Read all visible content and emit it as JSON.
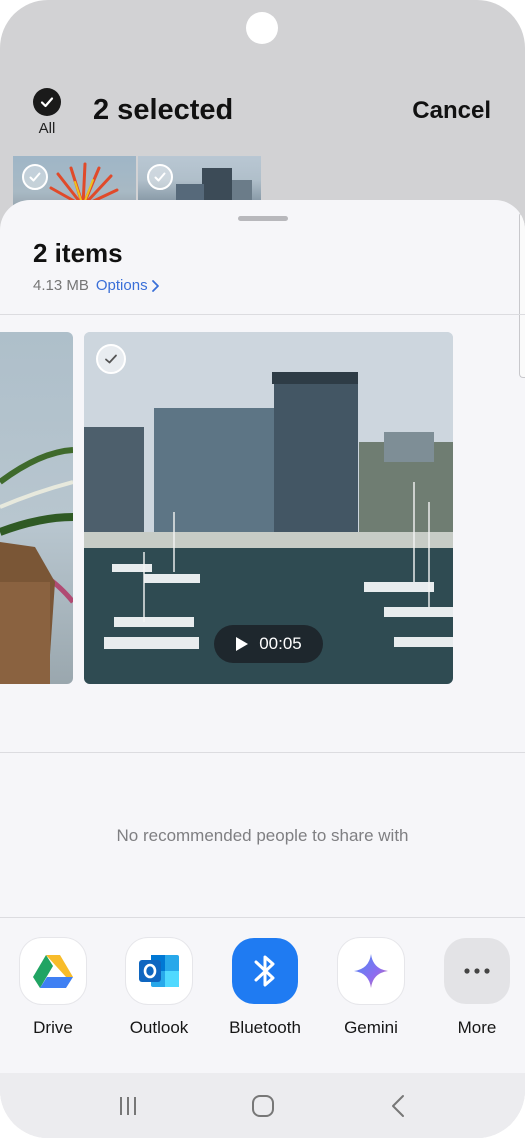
{
  "header": {
    "all_label": "All",
    "selected_title": "2 selected",
    "cancel_label": "Cancel"
  },
  "sheet": {
    "items_title": "2 items",
    "size": "4.13 MB",
    "options_label": "Options",
    "video_duration": "00:05",
    "no_recommend_text": "No recommended people to share with"
  },
  "apps": [
    {
      "label": "Drive",
      "icon": "google-drive-icon"
    },
    {
      "label": "Outlook",
      "icon": "outlook-icon"
    },
    {
      "label": "Bluetooth",
      "icon": "bluetooth-icon"
    },
    {
      "label": "Gemini",
      "icon": "gemini-icon"
    },
    {
      "label": "More",
      "icon": "more-dots-icon"
    }
  ],
  "navbar": {
    "buttons": [
      "recent-apps-icon",
      "home-icon",
      "back-icon"
    ]
  },
  "colors": {
    "accent_link": "#3a6fd8",
    "bluetooth": "#1f7bf2",
    "sheet_bg": "#f6f6f9"
  }
}
